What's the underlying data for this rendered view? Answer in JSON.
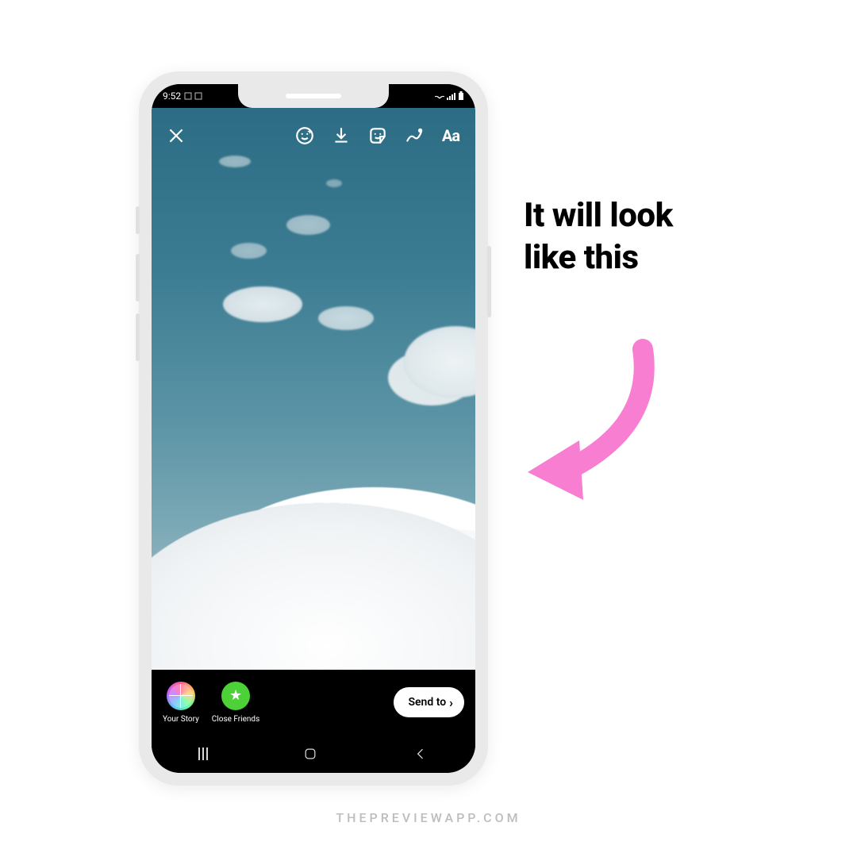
{
  "status": {
    "time": "9:52"
  },
  "toolbar": {
    "close": "close",
    "face_filter": "face-filter",
    "download": "download",
    "sticker": "sticker",
    "draw": "draw",
    "text_label": "Aa"
  },
  "share": {
    "your_story_label": "Your Story",
    "close_friends_label": "Close Friends",
    "send_to_label": "Send to"
  },
  "annotation": {
    "line1": "It will look",
    "line2": "like this"
  },
  "watermark": "THEPREVIEWAPP.COM",
  "colors": {
    "arrow": "#f77ed1",
    "close_friends": "#4cd137"
  }
}
